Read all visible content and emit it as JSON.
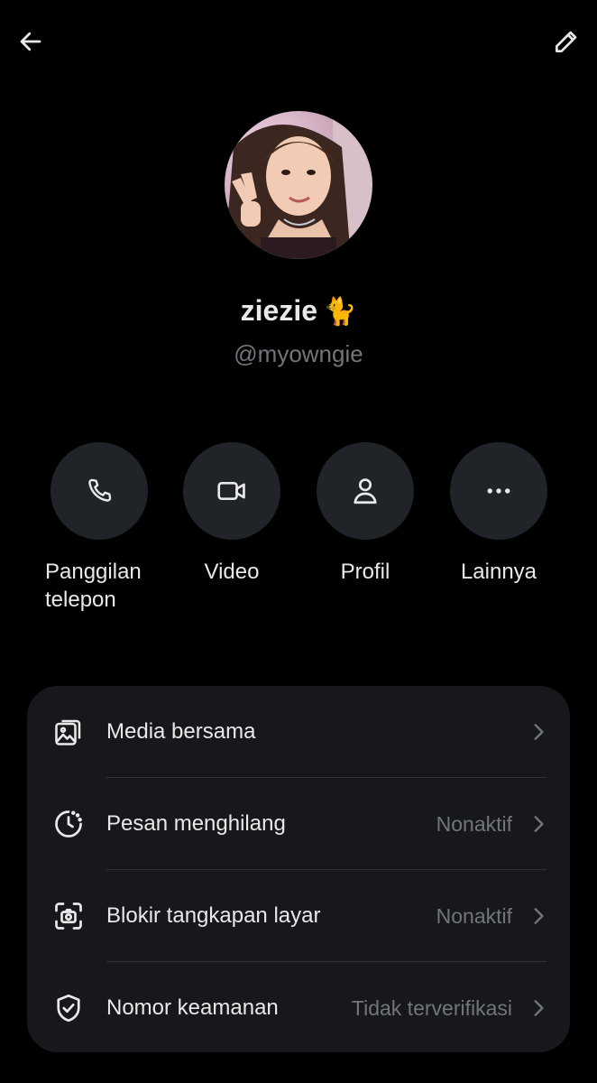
{
  "header": {
    "back_icon": "arrow-left-icon",
    "edit_icon": "pencil-icon"
  },
  "profile": {
    "name": "ziezie",
    "name_emoji": "🐈",
    "handle": "@myowngie"
  },
  "actions": [
    {
      "label_line1": "Panggilan",
      "label_line2": "telepon",
      "icon": "phone-icon"
    },
    {
      "label": "Video",
      "icon": "video-camera-icon"
    },
    {
      "label": "Profil",
      "icon": "person-icon"
    },
    {
      "label": "Lainnya",
      "icon": "more-horizontal-icon"
    }
  ],
  "settings": [
    {
      "label": "Media bersama",
      "value": "",
      "icon": "media-gallery-icon"
    },
    {
      "label": "Pesan menghilang",
      "value": "Nonaktif",
      "icon": "timer-icon"
    },
    {
      "label": "Blokir tangkapan layar",
      "value": "Nonaktif",
      "icon": "screenshot-camera-icon"
    },
    {
      "label": "Nomor keamanan",
      "value": "Tidak terverifikasi",
      "icon": "shield-check-icon"
    }
  ],
  "colors": {
    "background": "#000000",
    "card": "#16181c",
    "button_circle": "#202327",
    "text_primary": "#e7e9ea",
    "text_secondary": "#71767b"
  }
}
